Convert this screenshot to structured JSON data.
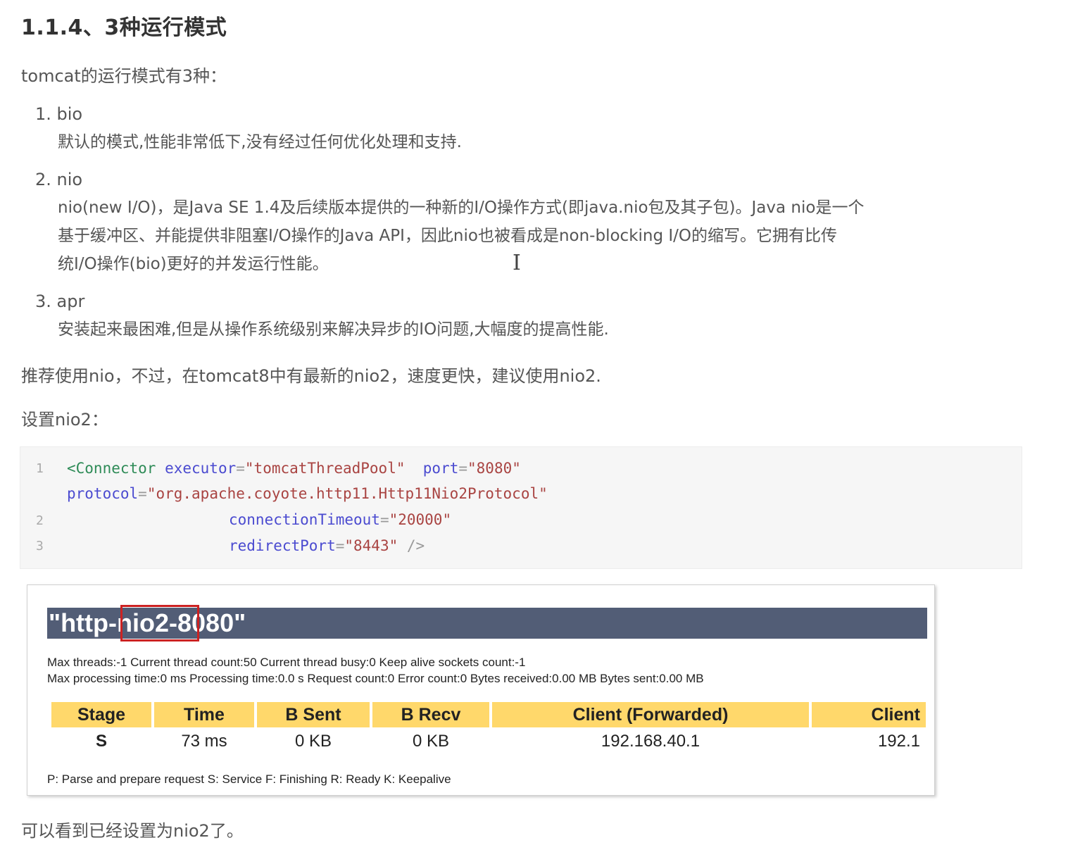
{
  "title": "1.1.4、3种运行模式",
  "intro": "tomcat的运行模式有3种：",
  "list": [
    {
      "num": "1. bio",
      "desc": [
        "默认的模式,性能非常低下,没有经过任何优化处理和支持."
      ]
    },
    {
      "num": "2. nio",
      "desc": [
        "nio(new I/O)，是Java SE 1.4及后续版本提供的一种新的I/O操作方式(即java.nio包及其子包)。Java nio是一个",
        "基于缓冲区、并能提供非阻塞I/O操作的Java API，因此nio也被看成是non-blocking I/O的缩写。它拥有比传",
        "统I/O操作(bio)更好的并发运行性能。"
      ]
    },
    {
      "num": "3. apr",
      "desc": [
        "安装起来最困难,但是从操作系统级别来解决异步的IO问题,大幅度的提高性能."
      ]
    }
  ],
  "recommend": "推荐使用nio，不过，在tomcat8中有最新的nio2，速度更快，建议使用nio2.",
  "setting_label": "设置nio2：",
  "code": {
    "line_numbers": [
      "1",
      "2",
      "3"
    ],
    "l1_tag": "<Connector",
    "l1_attr1": "executor",
    "l1_val1": "\"tomcatThreadPool\"",
    "l1_attr2": "port",
    "l1_val2": "\"8080\"",
    "l1b_attr": "protocol",
    "l1b_val": "\"org.apache.coyote.http11.Http11Nio2Protocol\"",
    "l2_attr": "connectionTimeout",
    "l2_val": "\"20000\"",
    "l3_attr": "redirectPort",
    "l3_val": "\"8443\"",
    "l3_close": "/>"
  },
  "panel": {
    "header": "\"http-nio2-8080\"",
    "stats_line1": "Max threads:-1 Current thread count:50 Current thread busy:0 Keep alive sockets count:-1",
    "stats_line2": "Max processing time:0 ms Processing time:0.0 s Request count:0 Error count:0 Bytes received:0.00 MB Bytes sent:0.00 MB",
    "table": {
      "headers": [
        "Stage",
        "Time",
        "B Sent",
        "B Recv",
        "Client (Forwarded)",
        "Client"
      ],
      "row": [
        "S",
        "73 ms",
        "0 KB",
        "0 KB",
        "192.168.40.1",
        "192.1"
      ]
    },
    "legend": "P: Parse and prepare request S: Service F: Finishing R: Ready K: Keepalive"
  },
  "closing": "可以看到已经设置为nio2了。",
  "colors": {
    "header_bg": "#525d76",
    "table_header_bg": "#ffd86b",
    "highlight_border": "#cc2222"
  }
}
